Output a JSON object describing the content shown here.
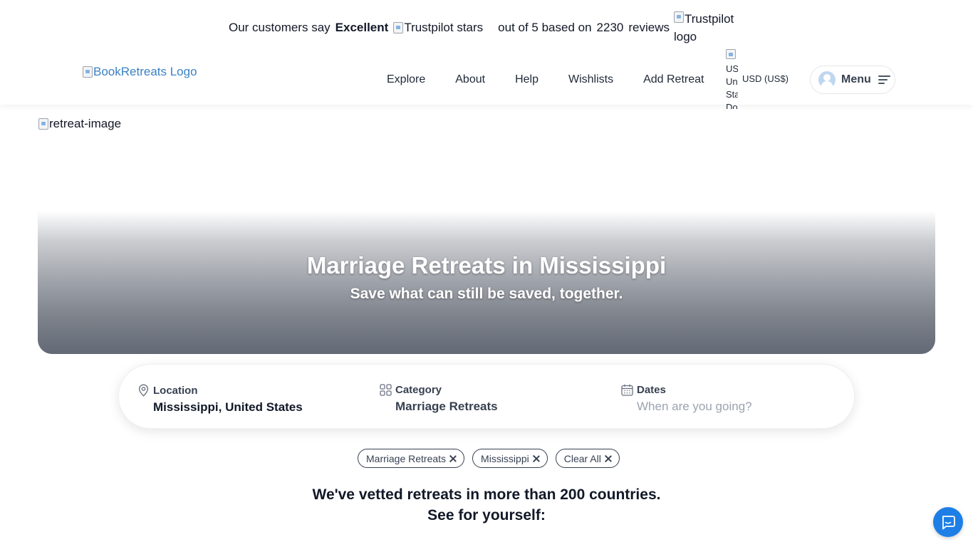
{
  "trustpilot": {
    "prefix": "Our customers say",
    "rating_word": "Excellent",
    "stars_alt": "Trustpilot stars",
    "out_of": "out of 5 based on",
    "review_count": "2230",
    "reviews_word": "reviews",
    "logo_alt": "Trustpilot logo"
  },
  "header": {
    "logo_alt": "BookRetreats Logo",
    "nav": [
      "Explore",
      "About",
      "Help",
      "Wishlists",
      "Add Retreat"
    ],
    "flag_alt": "US United States Dollar",
    "currency": "USD (US$)",
    "menu_label": "Menu"
  },
  "hero": {
    "image_alt": "retreat-image",
    "title": "Marriage Retreats in Mississippi",
    "subtitle": "Save what can still be saved, together."
  },
  "search": {
    "location_label": "Location",
    "location_value": "Mississippi, United States",
    "category_label": "Category",
    "category_value": "Marriage Retreats",
    "dates_label": "Dates",
    "dates_placeholder": "When are you going?"
  },
  "filters": [
    "Marriage Retreats",
    "Mississippi",
    "Clear All"
  ],
  "vetted": {
    "line1": "We've vetted retreats in more than 200 countries.",
    "line2": "See for yourself:"
  },
  "colors": {
    "link_blue": "#3b82c4",
    "chat_blue": "#1d7fe6",
    "hero_overlay": "#636975"
  }
}
